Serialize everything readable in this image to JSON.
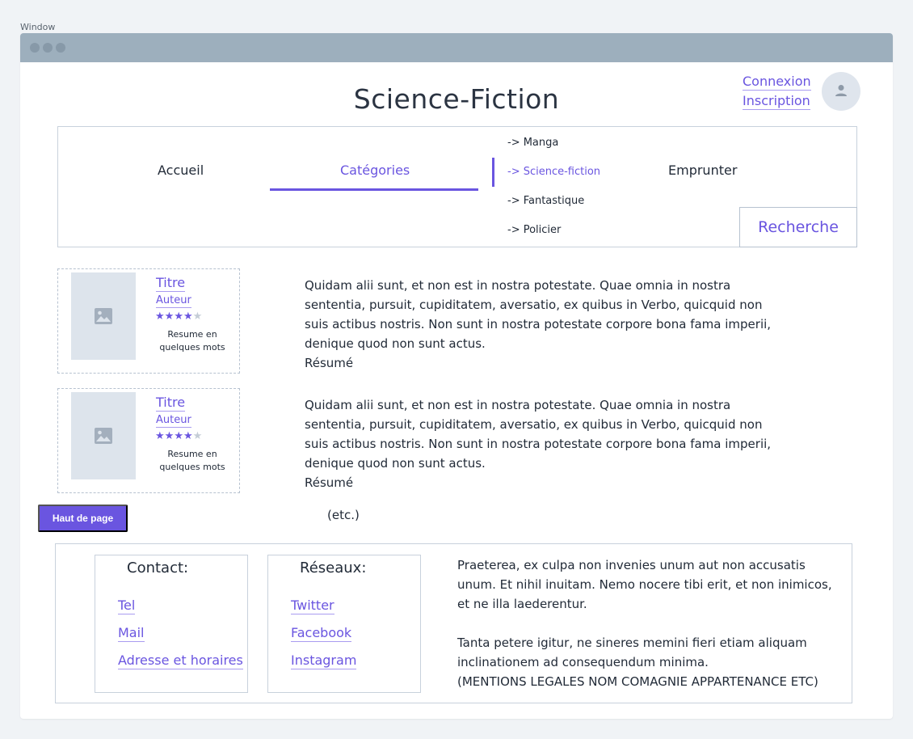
{
  "window": {
    "label": "Window"
  },
  "site": {
    "title": "Science-Fiction"
  },
  "auth": {
    "login": "Connexion",
    "register": "Inscription"
  },
  "nav": {
    "home": "Accueil",
    "categories": "Catégories",
    "borrow": "Emprunter",
    "submenu": [
      "-> Manga",
      "-> Science-fiction",
      "-> Fantastique",
      "-> Policier"
    ],
    "submenu_active_index": 1,
    "search": "Recherche"
  },
  "colors": {
    "accent": "#6a55e0",
    "border": "#c8d1dc",
    "titlebar": "#9dafbd"
  },
  "books": [
    {
      "title": "Titre",
      "author": "Auteur",
      "rating": 4,
      "rating_max": 5,
      "summary": "Resume en quelques mots",
      "description": "Quidam alii sunt, et non est in nostra potestate. Quae omnia in nostra sententia, pursuit, cupiditatem, aversatio, ex quibus in Verbo, quicquid non suis actibus nostris. Non sunt in nostra potestate corpore bona fama imperii, denique quod non sunt actus.",
      "description_label": "Résumé"
    },
    {
      "title": "Titre",
      "author": "Auteur",
      "rating": 4,
      "rating_max": 5,
      "summary": "Resume en quelques mots",
      "description": "Quidam alii sunt, et non est in nostra potestate. Quae omnia in nostra sententia, pursuit, cupiditatem, aversatio, ex quibus in Verbo, quicquid non suis actibus nostris. Non sunt in nostra potestate corpore bona fama imperii, denique quod non sunt actus.",
      "description_label": "Résumé"
    }
  ],
  "back_to_top": "Haut de page",
  "etc": "(etc.)",
  "footer": {
    "contact": {
      "title": "Contact:",
      "links": [
        "Tel",
        "Mail",
        "Adresse et horaires"
      ]
    },
    "networks": {
      "title": "Réseaux:",
      "links": [
        "Twitter",
        "Facebook",
        "Instagram"
      ]
    },
    "text1": "Praeterea, ex culpa non invenies unum aut non accusatis unum. Et nihil inuitam. Nemo nocere tibi erit, et non inimicos, et ne illa laederentur.",
    "text2": "Tanta petere igitur, ne sineres memini fieri etiam aliquam inclinationem ad consequendum minima.",
    "text3": "(MENTIONS LEGALES NOM COMAGNIE APPARTENANCE ETC)"
  },
  "icons": {
    "avatar": "user-icon",
    "book_cover": "image-icon",
    "rating": "star-icon"
  }
}
